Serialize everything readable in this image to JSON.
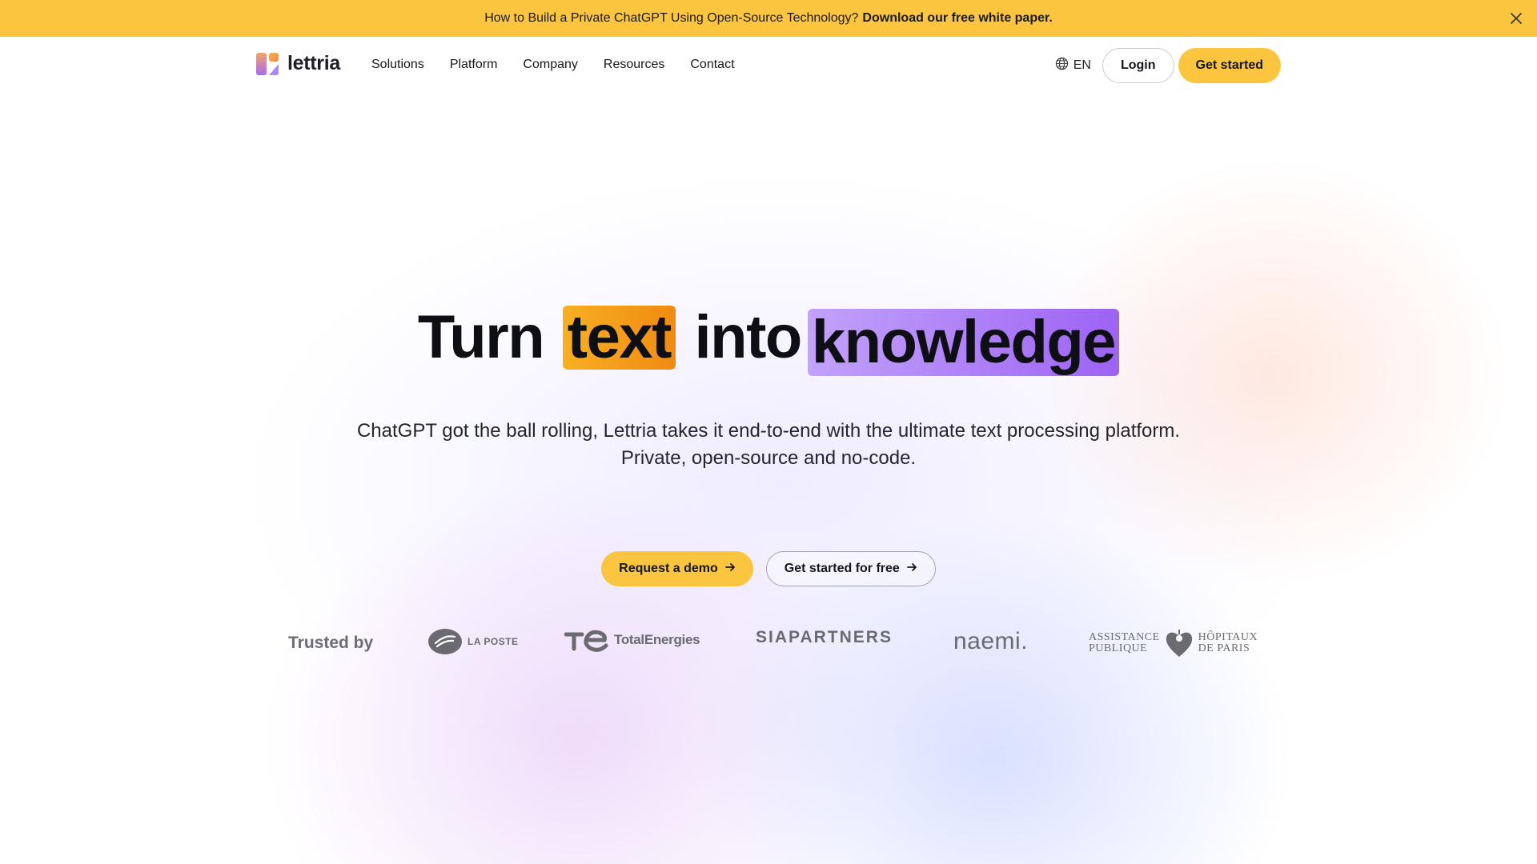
{
  "announcement": {
    "message": "How to Build a Private ChatGPT Using Open-Source Technology?",
    "link_text": "Download our free white paper.",
    "close_icon": "close-icon"
  },
  "nav": {
    "brand": "lettria",
    "links": [
      "Solutions",
      "Platform",
      "Company",
      "Resources",
      "Contact"
    ],
    "language": "EN",
    "login_label": "Login",
    "get_started_label": "Get started",
    "globe_icon": "globe-icon"
  },
  "hero": {
    "title_part1": "Turn",
    "title_highlight1": "text",
    "title_part2": "into",
    "title_highlight2": "knowledge",
    "subtitle": "ChatGPT got the ball rolling, Lettria takes it end-to-end with the ultimate text processing platform. Private, open-source and no-code.",
    "cta_demo": "Request a demo",
    "cta_free": "Get started for free"
  },
  "trusted": {
    "label": "Trusted by",
    "logos": {
      "laposte": "LA POSTE",
      "total": "TotalEnergies",
      "sia": "SIAPARTNERS",
      "naemi": "naemi.",
      "aphp_left_1": "ASSISTANCE",
      "aphp_left_2": "PUBLIQUE",
      "aphp_right_1": "HÔPITAUX",
      "aphp_right_2": "DE  PARIS"
    }
  },
  "colors": {
    "accent_yellow": "#fbc540",
    "highlight_orange": "#f39a18",
    "highlight_purple": "#a871f6"
  }
}
